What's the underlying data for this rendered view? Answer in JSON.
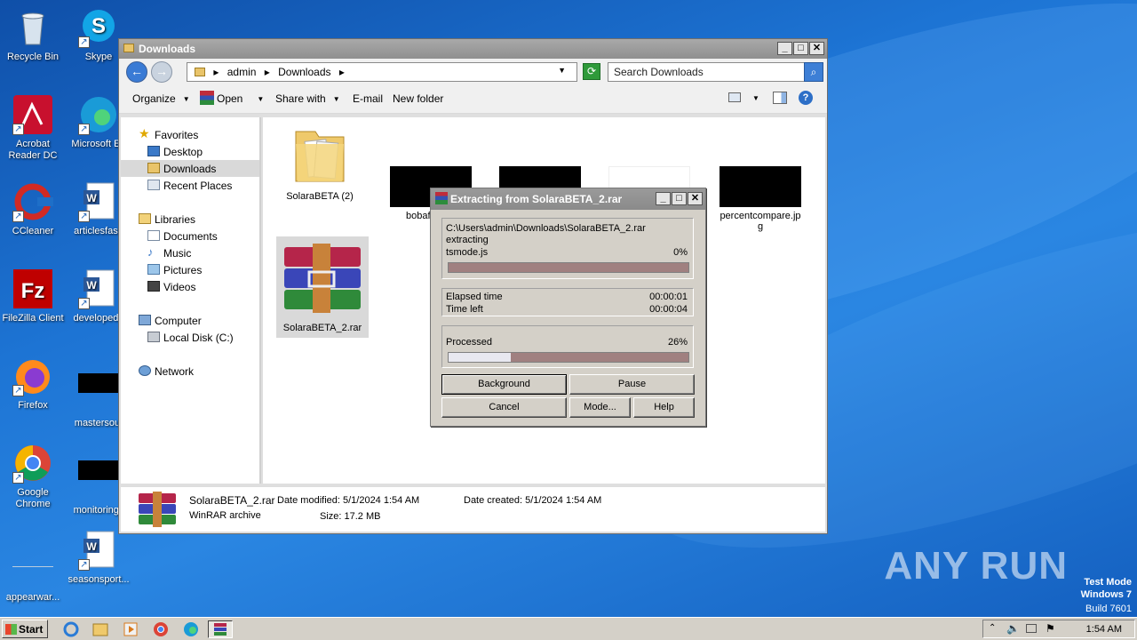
{
  "desktop": {
    "icons": [
      {
        "label": "Recycle Bin"
      },
      {
        "label": "Skype"
      },
      {
        "label": "Acrobat Reader DC"
      },
      {
        "label": "Microsoft Ed"
      },
      {
        "label": "CCleaner"
      },
      {
        "label": "articlesfast."
      },
      {
        "label": "FileZilla Client"
      },
      {
        "label": "developedu"
      },
      {
        "label": "Firefox"
      },
      {
        "label": "mastersout"
      },
      {
        "label": "Google Chrome"
      },
      {
        "label": "monitorings"
      },
      {
        "label": "appearwar..."
      },
      {
        "label": "seasonsport..."
      }
    ],
    "watermark": "ANY RUN",
    "test_mode": {
      "line1": "Test Mode",
      "line2": "Windows 7",
      "line3": "Build 7601"
    }
  },
  "explorer": {
    "title": "Downloads",
    "breadcrumb": [
      "admin",
      "Downloads"
    ],
    "search_placeholder": "Search Downloads",
    "toolbar": {
      "organize": "Organize",
      "open": "Open",
      "share_with": "Share with",
      "email": "E-mail",
      "new_folder": "New folder"
    },
    "nav": {
      "favorites": "Favorites",
      "desktop": "Desktop",
      "downloads": "Downloads",
      "recent_places": "Recent Places",
      "libraries": "Libraries",
      "documents": "Documents",
      "music": "Music",
      "pictures": "Pictures",
      "videos": "Videos",
      "computer": "Computer",
      "local_disk": "Local Disk (C:)",
      "network": "Network"
    },
    "files": [
      {
        "name": "SolaraBETA (2)"
      },
      {
        "name": "bobaf"
      },
      {
        "name": "percentcompare.jpg"
      },
      {
        "name": "SolaraBETA_2.rar"
      }
    ],
    "details": {
      "name": "SolaraBETA_2.rar",
      "type": "WinRAR archive",
      "date_modified": "Date modified: 5/1/2024 1:54 AM",
      "size": "Size: 17.2 MB",
      "date_created": "Date created: 5/1/2024 1:54 AM"
    }
  },
  "rar_dialog": {
    "title": "Extracting from SolaraBETA_2.rar",
    "archive_path": "C:\\Users\\admin\\Downloads\\SolaraBETA_2.rar",
    "action": "extracting",
    "current_file": "tsmode.js",
    "file_percent": "0%",
    "file_progress": 0,
    "elapsed_label": "Elapsed time",
    "elapsed_value": "00:00:01",
    "left_label": "Time left",
    "left_value": "00:00:04",
    "processed_label": "Processed",
    "processed_percent": "26%",
    "processed_progress": 0.26,
    "buttons": {
      "background": "Background",
      "pause": "Pause",
      "cancel": "Cancel",
      "mode": "Mode...",
      "help": "Help"
    }
  },
  "taskbar": {
    "start": "Start",
    "clock": "1:54 AM"
  }
}
